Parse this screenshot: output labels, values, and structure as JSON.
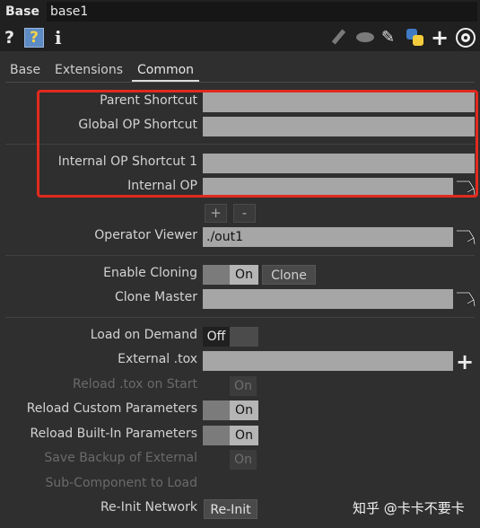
{
  "header": {
    "op_type": "Base",
    "op_name": "base1"
  },
  "icons": {
    "help": "question-mark-icon",
    "python_help": "python-help-icon",
    "info": "info-icon",
    "tools": [
      "pencil-icon",
      "comment-bubble-icon",
      "clipboard-icon",
      "python-icon",
      "plus-icon",
      "target-icon"
    ]
  },
  "tabs": [
    {
      "label": "Base"
    },
    {
      "label": "Extensions"
    },
    {
      "label": "Common",
      "active": true
    }
  ],
  "params": {
    "parent_shortcut": {
      "label": "Parent Shortcut",
      "value": ""
    },
    "global_op_shortcut": {
      "label": "Global OP Shortcut",
      "value": ""
    },
    "internal_op_shortcut_1": {
      "label": "Internal OP Shortcut 1",
      "value": ""
    },
    "internal_op": {
      "label": "Internal OP",
      "value": ""
    },
    "add_button": "+",
    "remove_button": "-",
    "operator_viewer": {
      "label": "Operator Viewer",
      "value": "./out1"
    },
    "enable_cloning": {
      "label": "Enable Cloning",
      "state": "On",
      "button": "Clone"
    },
    "clone_master": {
      "label": "Clone Master",
      "value": ""
    },
    "load_on_demand": {
      "label": "Load on Demand",
      "state": "Off"
    },
    "external_tox": {
      "label": "External .tox",
      "value": ""
    },
    "reload_tox_on_start": {
      "label": "Reload .tox on Start",
      "state": "On"
    },
    "reload_custom_parameters": {
      "label": "Reload Custom Parameters",
      "state": "On"
    },
    "reload_builtin_parameters": {
      "label": "Reload Built-In Parameters",
      "state": "On"
    },
    "save_backup_of_external": {
      "label": "Save Backup of External",
      "state": "On"
    },
    "sub_component_to_load": {
      "label": "Sub-Component to Load"
    },
    "reinit_network": {
      "label": "Re-Init Network",
      "button": "Re-Init"
    }
  },
  "watermark": "知乎 @卡卡不要卡",
  "colors": {
    "highlight_box": "#e02a1e",
    "field_bg": "#a6a6a6",
    "panel_bg": "#2f2f2f"
  }
}
